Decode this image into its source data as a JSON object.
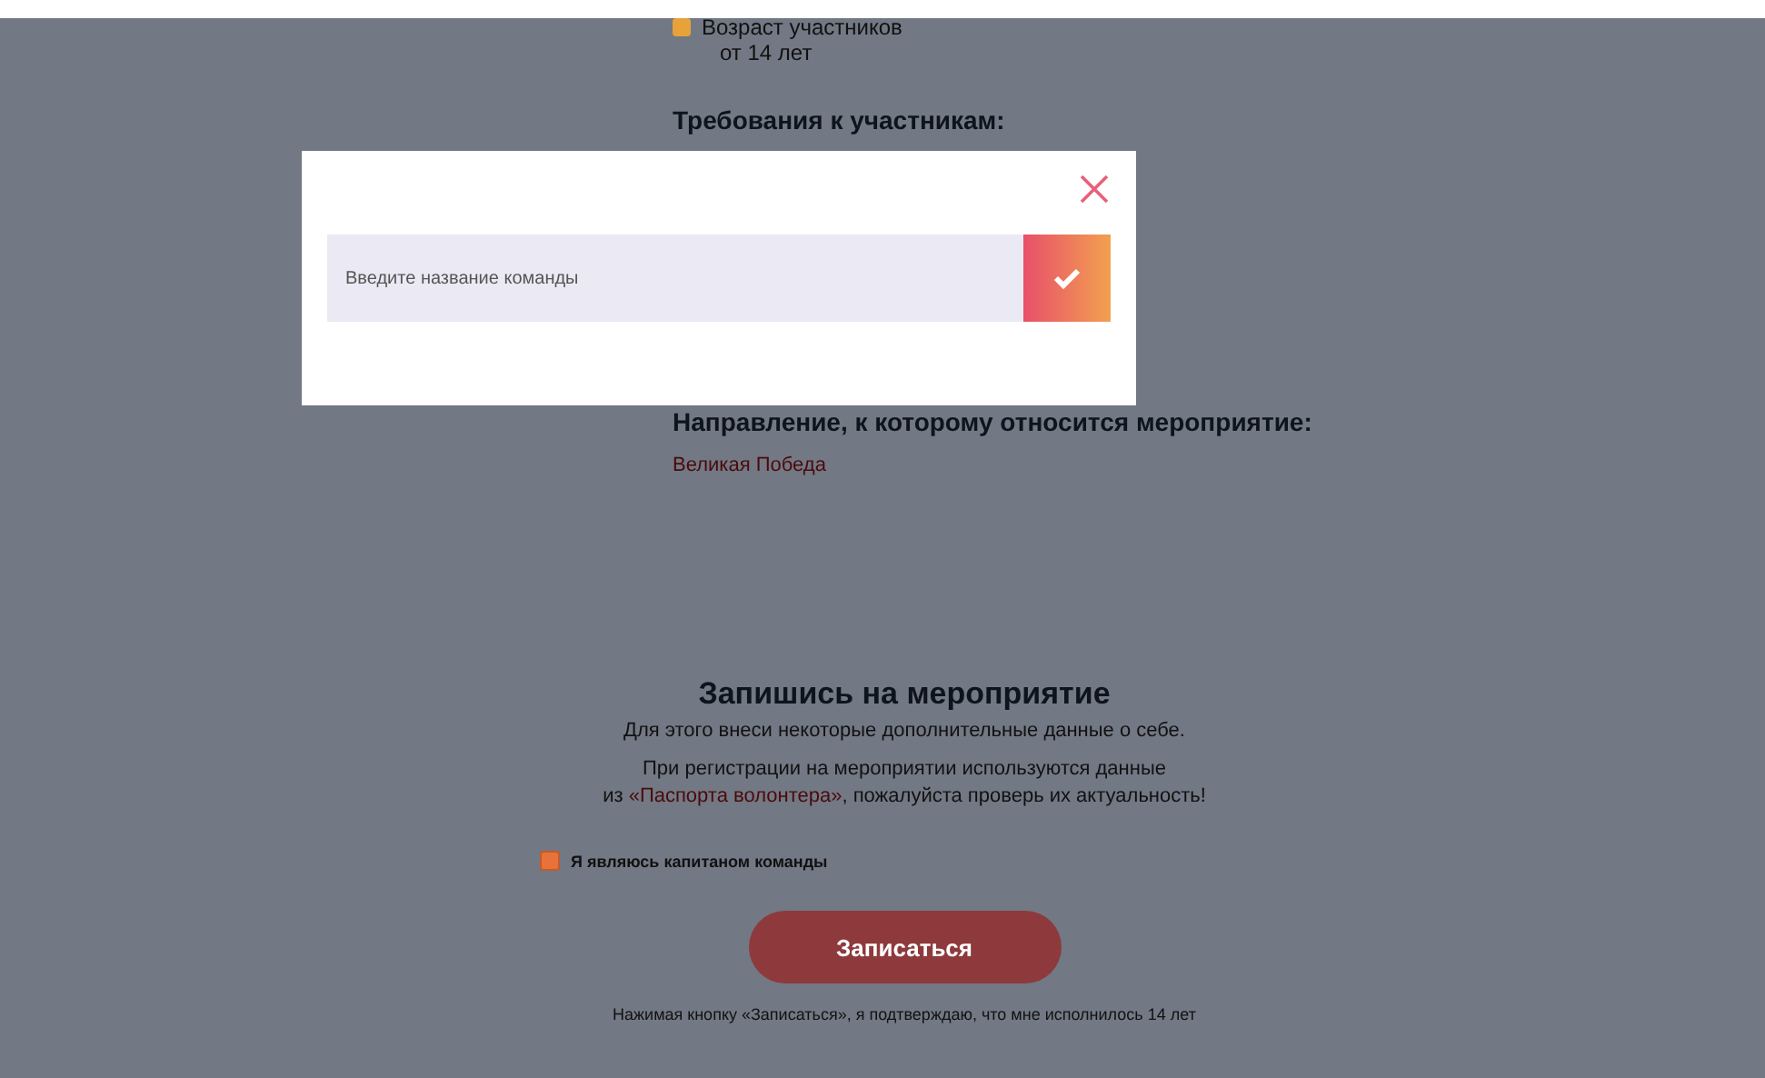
{
  "event_info": {
    "age_label": "Возраст участников",
    "age_value": "от 14 лет",
    "requirements_heading": "Требования к участникам:",
    "direction_heading": "Направление, к которому относится мероприятие:",
    "direction_value": "Великая Победа"
  },
  "signup": {
    "title": "Запишись на мероприятие",
    "subtitle": "Для этого внеси некоторые дополнительные данные о себе.",
    "notice_before": "При регистрации на мероприятии используются данные",
    "notice_prefix": "из",
    "notice_link": "«Паспорта волонтера»",
    "notice_after": ", пожалуйста проверь их актуальность!",
    "captain_checkbox": {
      "label": "Я являюсь капитаном команды",
      "checked": true
    },
    "button": "Записаться",
    "disclaimer": "Нажимая кнопку «Записаться», я подтверждаю, что мне исполнилось 14 лет"
  },
  "modal": {
    "open": true,
    "team_name_field": {
      "placeholder": "Введите название команды"
    }
  }
}
